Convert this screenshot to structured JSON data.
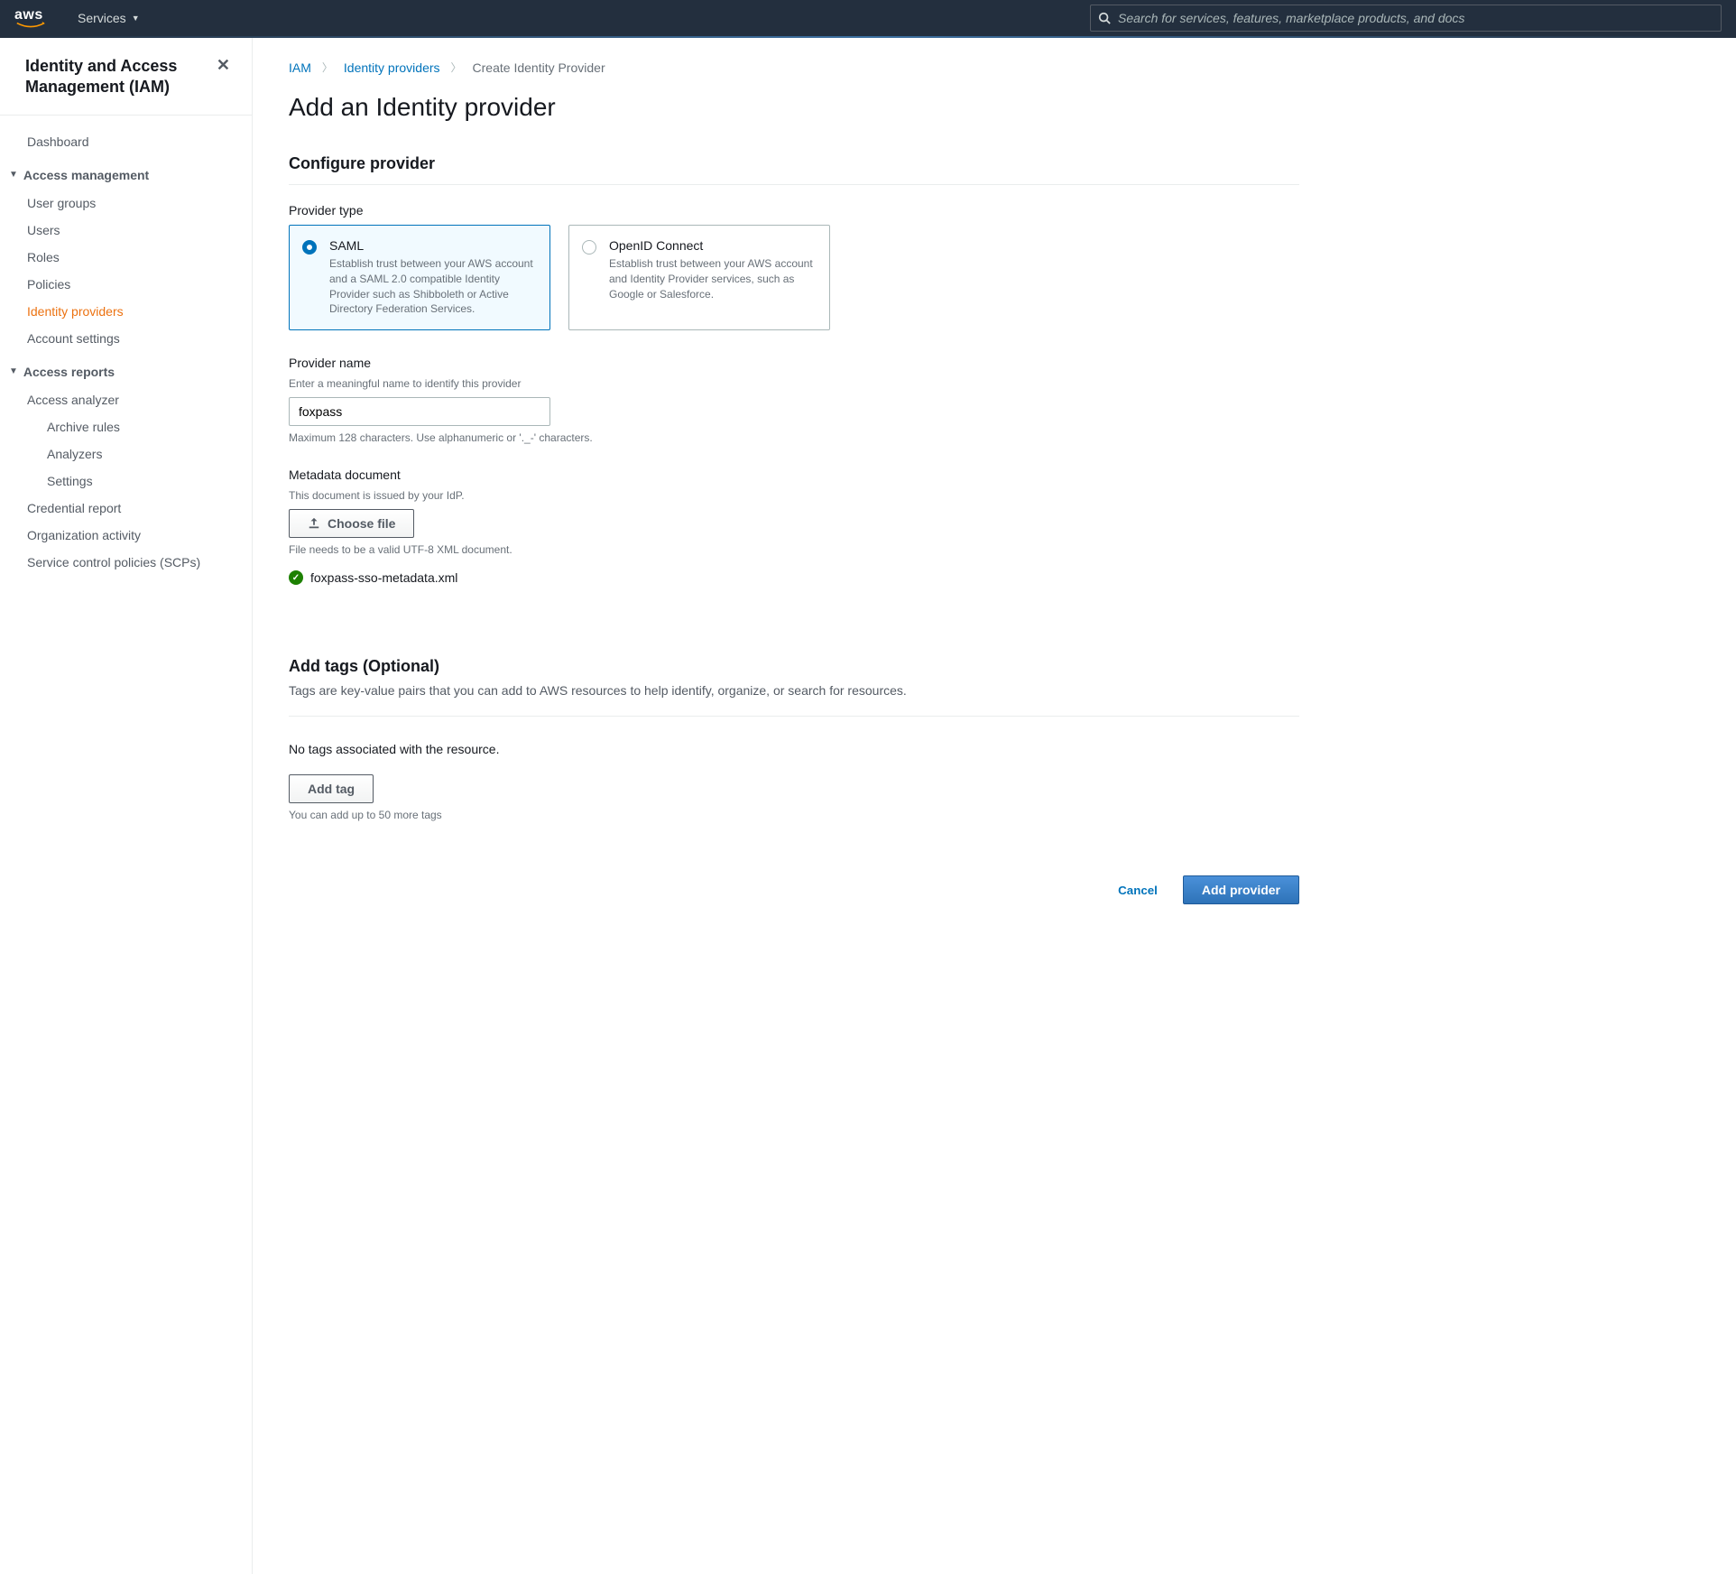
{
  "topnav": {
    "logo_text": "aws",
    "services_label": "Services",
    "search_placeholder": "Search for services, features, marketplace products, and docs"
  },
  "sidebar": {
    "title": "Identity and Access Management (IAM)",
    "items": {
      "dashboard": "Dashboard",
      "access_mgmt_header": "Access management",
      "user_groups": "User groups",
      "users": "Users",
      "roles": "Roles",
      "policies": "Policies",
      "identity_providers": "Identity providers",
      "account_settings": "Account settings",
      "access_reports_header": "Access reports",
      "access_analyzer": "Access analyzer",
      "archive_rules": "Archive rules",
      "analyzers": "Analyzers",
      "settings": "Settings",
      "credential_report": "Credential report",
      "organization_activity": "Organization activity",
      "scps": "Service control policies (SCPs)"
    }
  },
  "breadcrumb": {
    "iam": "IAM",
    "identity_providers": "Identity providers",
    "current": "Create Identity Provider"
  },
  "page": {
    "title": "Add an Identity provider",
    "configure_header": "Configure provider",
    "provider_type_label": "Provider type",
    "tiles": {
      "saml": {
        "title": "SAML",
        "desc": "Establish trust between your AWS account and a SAML 2.0 compatible Identity Provider such as Shibboleth or Active Directory Federation Services."
      },
      "oidc": {
        "title": "OpenID Connect",
        "desc": "Establish trust between your AWS account and Identity Provider services, such as Google or Salesforce."
      }
    },
    "provider_name": {
      "label": "Provider name",
      "hint": "Enter a meaningful name to identify this provider",
      "value": "foxpass",
      "constraint": "Maximum 128 characters. Use alphanumeric or '._-' characters."
    },
    "metadata": {
      "label": "Metadata document",
      "hint": "This document is issued by your IdP.",
      "button": "Choose file",
      "constraint": "File needs to be a valid UTF-8 XML document.",
      "uploaded_file": "foxpass-sso-metadata.xml"
    },
    "tags": {
      "header": "Add tags (Optional)",
      "desc": "Tags are key-value pairs that you can add to AWS resources to help identify, organize, or search for resources.",
      "none": "No tags associated with the resource.",
      "add_button": "Add tag",
      "limit": "You can add up to 50 more tags"
    },
    "footer": {
      "cancel": "Cancel",
      "add": "Add provider"
    }
  }
}
